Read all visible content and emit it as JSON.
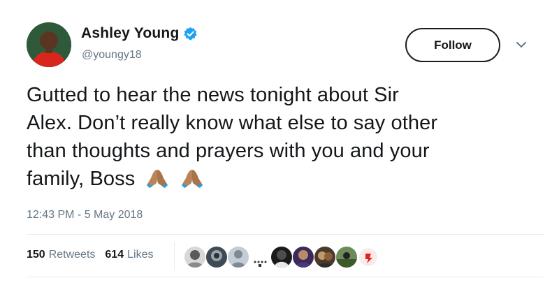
{
  "author": {
    "display_name": "Ashley Young",
    "handle": "@youngy18",
    "verified_icon": "verified-badge-icon",
    "avatar_icon": "profile-photo"
  },
  "follow_button": {
    "label": "Follow"
  },
  "tweet": {
    "line1": "Gutted to hear the news tonight about Sir",
    "line2": "Alex. Don’t really know what else to say other",
    "line3": "than thoughts and prayers with you and your",
    "line4": "family, Boss",
    "emoji_icons": [
      "folded-hands-icon",
      "folded-hands-icon"
    ],
    "timestamp": "12:43 PM - 5 May 2018"
  },
  "stats": {
    "retweets_count": "150",
    "retweets_label": "Retweets",
    "likes_count": "614",
    "likes_label": "Likes"
  },
  "likers": [
    "liker-avatar-1",
    "liker-avatar-2",
    "liker-avatar-3",
    "liker-avatar-4",
    "liker-avatar-5",
    "liker-avatar-6",
    "liker-avatar-7",
    "liker-avatar-8",
    "liker-avatar-9"
  ],
  "colors": {
    "text": "#14171a",
    "secondary": "#657786",
    "verified_blue": "#1da1f2",
    "divider": "#e6ecf0",
    "skin_tone": "#b98459"
  }
}
